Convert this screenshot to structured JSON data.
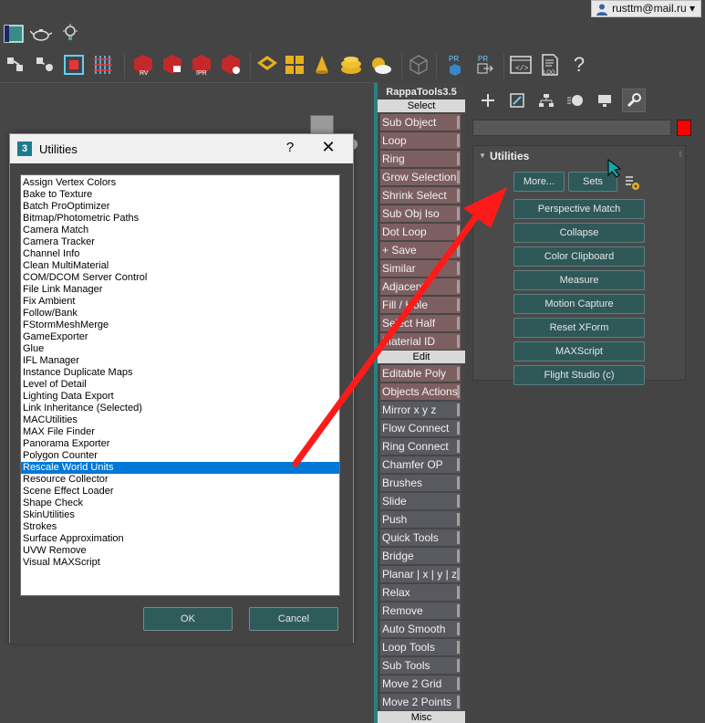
{
  "user": {
    "email": "rusttm@mail.ru",
    "dropdown_glyph": "▾"
  },
  "toolbar_icons": {
    "row1": [
      "viewport-layout-icon",
      "teapot-icon",
      "lightbulb-icon"
    ],
    "row2": [
      "select-link-icon",
      "unlink-icon",
      "bind-space-warp-icon",
      "selection-filter-icon",
      "render-rv-icon",
      "render-frame-icon",
      "render-ipr-icon",
      "render-setup-icon",
      "mesh-tools-icon",
      "grid-layout-icon",
      "cone-icon",
      "stacked-disk-icon",
      "cloud-sun-icon",
      "cube-wireframe-icon",
      "pr-render-icon",
      "pr-export-icon",
      "script-editor-icon",
      "log-icon",
      "help-icon"
    ],
    "labels": {
      "rv": "RV",
      "ipr": "IPR",
      "pr1": "PR",
      "pr2": "PR",
      "log": "LOG",
      "help": "?"
    }
  },
  "dialog": {
    "title": "Utilities",
    "logo": "3",
    "help": "?",
    "close": "✕",
    "items": [
      "Assign Vertex Colors",
      "Bake to Texture",
      "Batch ProOptimizer",
      "Bitmap/Photometric Paths",
      "Camera Match",
      "Camera Tracker",
      "Channel Info",
      "Clean MultiMaterial",
      "COM/DCOM Server Control",
      "File Link Manager",
      "Fix Ambient",
      "Follow/Bank",
      "FStormMeshMerge",
      "GameExporter",
      "Glue",
      "IFL Manager",
      "Instance Duplicate Maps",
      "Level of Detail",
      "Lighting Data Export",
      "Link Inheritance (Selected)",
      "MACUtilities",
      "MAX File Finder",
      "Panorama Exporter",
      "Polygon Counter",
      "Rescale World Units",
      "Resource Collector",
      "Scene Effect Loader",
      "Shape Check",
      "SkinUtilities",
      "Strokes",
      "Surface Approximation",
      "UVW Remove",
      "Visual MAXScript"
    ],
    "selected_item": "Rescale World Units",
    "ok_label": "OK",
    "cancel_label": "Cancel"
  },
  "rappa": {
    "title": "RappaTools3.5",
    "sections": {
      "select": "Select",
      "edit": "Edit",
      "misc": "Misc"
    },
    "select_buttons": [
      {
        "label": "Sub Object",
        "style": "pink"
      },
      {
        "label": "Loop",
        "style": "pink"
      },
      {
        "label": "Ring",
        "style": "pink"
      },
      {
        "label": "Grow Selection",
        "style": "pink"
      },
      {
        "label": "Shrink Select",
        "style": "pink"
      },
      {
        "label": "Sub Obj Iso",
        "style": "pink"
      },
      {
        "label": "Dot Loop",
        "style": "pink"
      },
      {
        "label": "+ Save",
        "style": "pink"
      },
      {
        "label": "Similar",
        "style": "pink"
      },
      {
        "label": "Adjacent",
        "style": "pink"
      },
      {
        "label": "Fill / Hole",
        "style": "pink"
      },
      {
        "label": "Select Half",
        "style": "pink"
      },
      {
        "label": "Material ID",
        "style": "pink"
      }
    ],
    "edit_buttons": [
      {
        "label": "Editable Poly",
        "style": "pink"
      },
      {
        "label": "Objects Actions",
        "style": "pink"
      },
      {
        "label": "Mirror   x  y  z",
        "style": "gray"
      },
      {
        "label": "Flow Connect",
        "style": "gray"
      },
      {
        "label": "Ring Connect",
        "style": "gray"
      },
      {
        "label": "Chamfer OP",
        "style": "gray"
      },
      {
        "label": "Brushes",
        "style": "gray"
      },
      {
        "label": "Slide",
        "style": "gray"
      },
      {
        "label": "Push",
        "style": "gray"
      },
      {
        "label": "Quick Tools",
        "style": "gray"
      },
      {
        "label": "Bridge",
        "style": "gray"
      },
      {
        "label": "Planar | x | y | z",
        "style": "gray"
      },
      {
        "label": "Relax",
        "style": "gray"
      },
      {
        "label": "Remove",
        "style": "gray"
      },
      {
        "label": "Auto Smooth",
        "style": "gray"
      },
      {
        "label": "Loop Tools",
        "style": "gray"
      },
      {
        "label": "Sub Tools",
        "style": "gray"
      },
      {
        "label": "Move 2 Grid",
        "style": "gray"
      },
      {
        "label": "Move 2 Points",
        "style": "gray"
      }
    ]
  },
  "command_panel": {
    "tabs": [
      "create-tab-icon",
      "modify-tab-icon",
      "hierarchy-tab-icon",
      "motion-tab-icon",
      "display-tab-icon",
      "utilities-tab-icon"
    ],
    "active_tab": "utilities-tab-icon",
    "swatch_color": "#ff0000",
    "rollout_title": "Utilities",
    "more_label": "More...",
    "sets_label": "Sets",
    "utility_buttons": [
      "Perspective Match",
      "Collapse",
      "Color Clipboard",
      "Measure",
      "Motion Capture",
      "Reset XForm",
      "MAXScript",
      "Flight Studio (c)"
    ]
  },
  "colors": {
    "accent_teal": "#2a8080",
    "button_teal": "#2f5858",
    "rappa_pink": "#7d5f61",
    "rappa_gray": "#595960",
    "selection_blue": "#0078d7",
    "annotation_red": "#ff1a1a"
  }
}
